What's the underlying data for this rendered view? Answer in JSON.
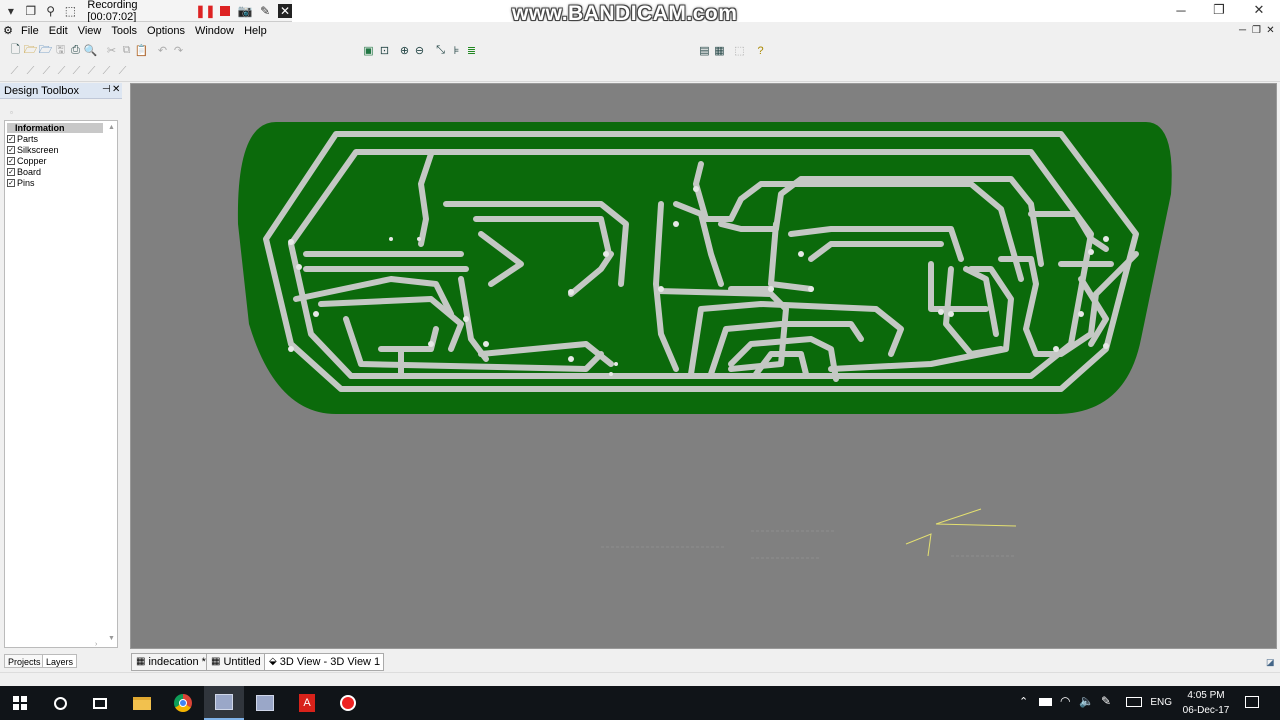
{
  "recorder": {
    "status": "Recording [00:07:02]",
    "watermark": "www.BANDICAM.com"
  },
  "menu": [
    "File",
    "Edit",
    "View",
    "Tools",
    "Options",
    "Window",
    "Help"
  ],
  "toolbox": {
    "title": "Design Toolbox",
    "header": "Information",
    "layers": [
      {
        "label": "Parts",
        "checked": true
      },
      {
        "label": "Silkscreen",
        "checked": true
      },
      {
        "label": "Copper",
        "checked": true
      },
      {
        "label": "Board",
        "checked": true
      },
      {
        "label": "Pins",
        "checked": true
      }
    ],
    "tabs": [
      "Projects",
      "Layers"
    ]
  },
  "doc_tabs": [
    "indecation *",
    "Untitled",
    "3D View - 3D View 1"
  ],
  "taskbar": {
    "language": "ENG",
    "time": "4:05 PM",
    "date": "06-Dec-17"
  },
  "colors": {
    "board": "#0b6a0b",
    "traces": "#c4c8c4",
    "viewport": "#808080",
    "taskbar": "#101418"
  }
}
